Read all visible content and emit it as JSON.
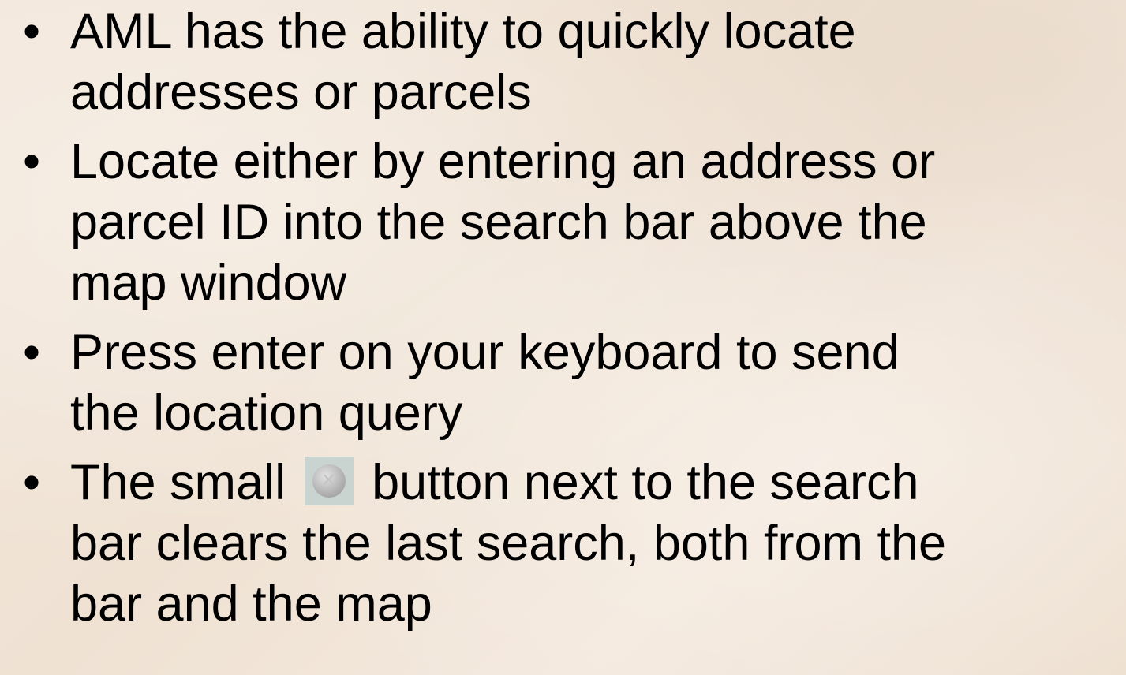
{
  "bullets": [
    {
      "lines": [
        "AML has the ability to quickly locate",
        "addresses or parcels"
      ]
    },
    {
      "lines": [
        "Locate either by entering an address or",
        "parcel ID into the search bar above the",
        "map window"
      ]
    },
    {
      "lines": [
        "Press enter on your keyboard to send",
        "the location query"
      ]
    },
    {
      "line1_before": "The small",
      "line1_after": "button next to the search",
      "lines_rest": [
        "bar clears the last search, both from the",
        "bar and the map"
      ]
    }
  ],
  "bullet_symbol": "•",
  "icons": {
    "clear_button": "clear-x-icon"
  }
}
